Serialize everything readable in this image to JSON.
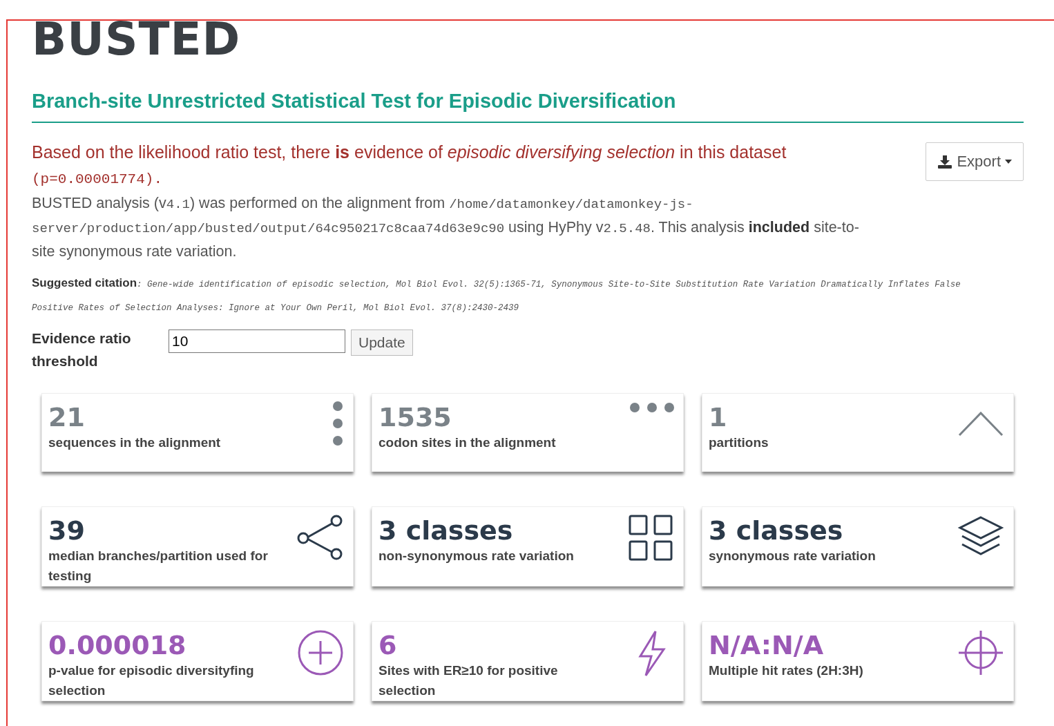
{
  "title": "BUSTED",
  "subtitle": "Branch-site Unrestricted Statistical Test for Episodic Diversification",
  "result": [
    {
      "kind": "text",
      "text": "Based on the likelihood ratio test, there "
    },
    {
      "kind": "bold",
      "text": "is"
    },
    {
      "kind": "text",
      "text": " evidence of "
    },
    {
      "kind": "italic",
      "text": "episodic diversifying selection"
    },
    {
      "kind": "text",
      "text": " in this dataset "
    },
    {
      "kind": "mono",
      "text": "(p=0.00001774)."
    }
  ],
  "export_button": {
    "label": "Export"
  },
  "analysis": [
    {
      "kind": "text",
      "text": "BUSTED analysis (v"
    },
    {
      "kind": "mono",
      "text": "4.1"
    },
    {
      "kind": "text",
      "text": ") was performed on the alignment from "
    },
    {
      "kind": "mono",
      "text": "/home/datamonkey/datamonkey-js-server/production/app/busted/output/64c950217c8caa74d63e9c90"
    },
    {
      "kind": "text",
      "text": " using HyPhy v"
    },
    {
      "kind": "mono",
      "text": "2.5.48"
    },
    {
      "kind": "text",
      "text": ". This analysis "
    },
    {
      "kind": "bold",
      "text": "included"
    },
    {
      "kind": "text",
      "text": " site-to-site synonymous rate variation."
    }
  ],
  "citation": {
    "label": "Suggested citation",
    "text": ": Gene-wide identification of episodic selection, Mol Biol Evol. 32(5):1365-71, Synonymous Site-to-Site Substitution Rate Variation Dramatically Inflates False Positive Rates of Selection Analyses: Ignore at Your Own Peril, Mol Biol Evol. 37(8):2430-2439"
  },
  "threshold": {
    "label": "Evidence ratio threshold",
    "value": "10",
    "button": "Update"
  },
  "cards": [
    {
      "value": "21",
      "label": "sequences in the alignment",
      "color": "#7a8288"
    },
    {
      "value": "1535",
      "label": "codon sites in the alignment",
      "color": "#7a8288"
    },
    {
      "value": "1",
      "label": "partitions",
      "color": "#7a8288"
    },
    {
      "value": "39",
      "label": "median branches/partition used for testing",
      "color": "#2b3a4a"
    },
    {
      "value": "3 classes",
      "label": "non-synonymous rate variation",
      "color": "#2b3a4a"
    },
    {
      "value": "3 classes",
      "label": "synonymous rate variation",
      "color": "#2b3a4a"
    },
    {
      "value": "0.000018",
      "label": "p-value for episodic diversityfing selection",
      "color": "#9b59b6"
    },
    {
      "value": "6",
      "label": "Sites with ER≥10 for positive selection",
      "color": "#9b59b6"
    },
    {
      "value": "N/A:N/A",
      "label": "Multiple hit rates (2H:3H)",
      "color": "#9b59b6"
    }
  ]
}
